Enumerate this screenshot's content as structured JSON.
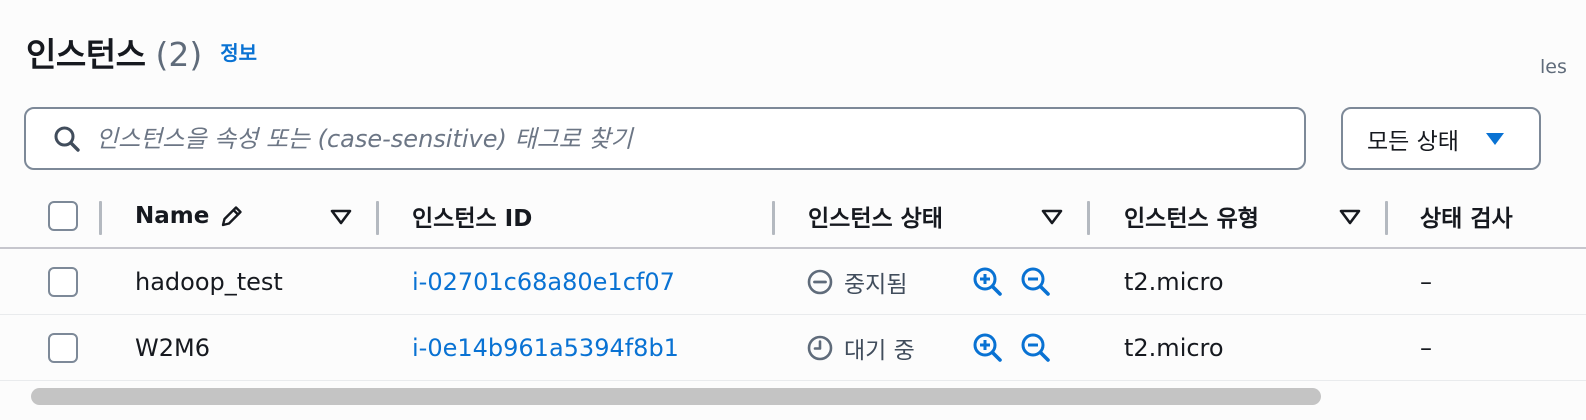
{
  "header": {
    "title": "인스턴스",
    "count": "(2)",
    "info_link": "정보",
    "right_cut_text": "les"
  },
  "search": {
    "placeholder": "인스턴스을 속성 또는 (case-sensitive) 태그로 찾기",
    "value": ""
  },
  "filter": {
    "label": "모든 상태"
  },
  "table": {
    "columns": {
      "name": "Name",
      "instance_id": "인스턴스 ID",
      "instance_state": "인스턴스 상태",
      "instance_type": "인스턴스 유형",
      "status_check": "상태 검사"
    },
    "rows": [
      {
        "name": "hadoop_test",
        "instance_id": "i-02701c68a80e1cf07",
        "state": "중지됨",
        "state_icon": "stopped-icon",
        "type": "t2.micro",
        "status_check": "–"
      },
      {
        "name": "W2M6",
        "instance_id": "i-0e14b961a5394f8b1",
        "state": "대기 중",
        "state_icon": "pending-clock-icon",
        "type": "t2.micro",
        "status_check": "–"
      }
    ]
  },
  "colors": {
    "link": "#0972d3",
    "border": "#7d8998",
    "text": "#16191f",
    "muted": "#5f6b7a"
  }
}
